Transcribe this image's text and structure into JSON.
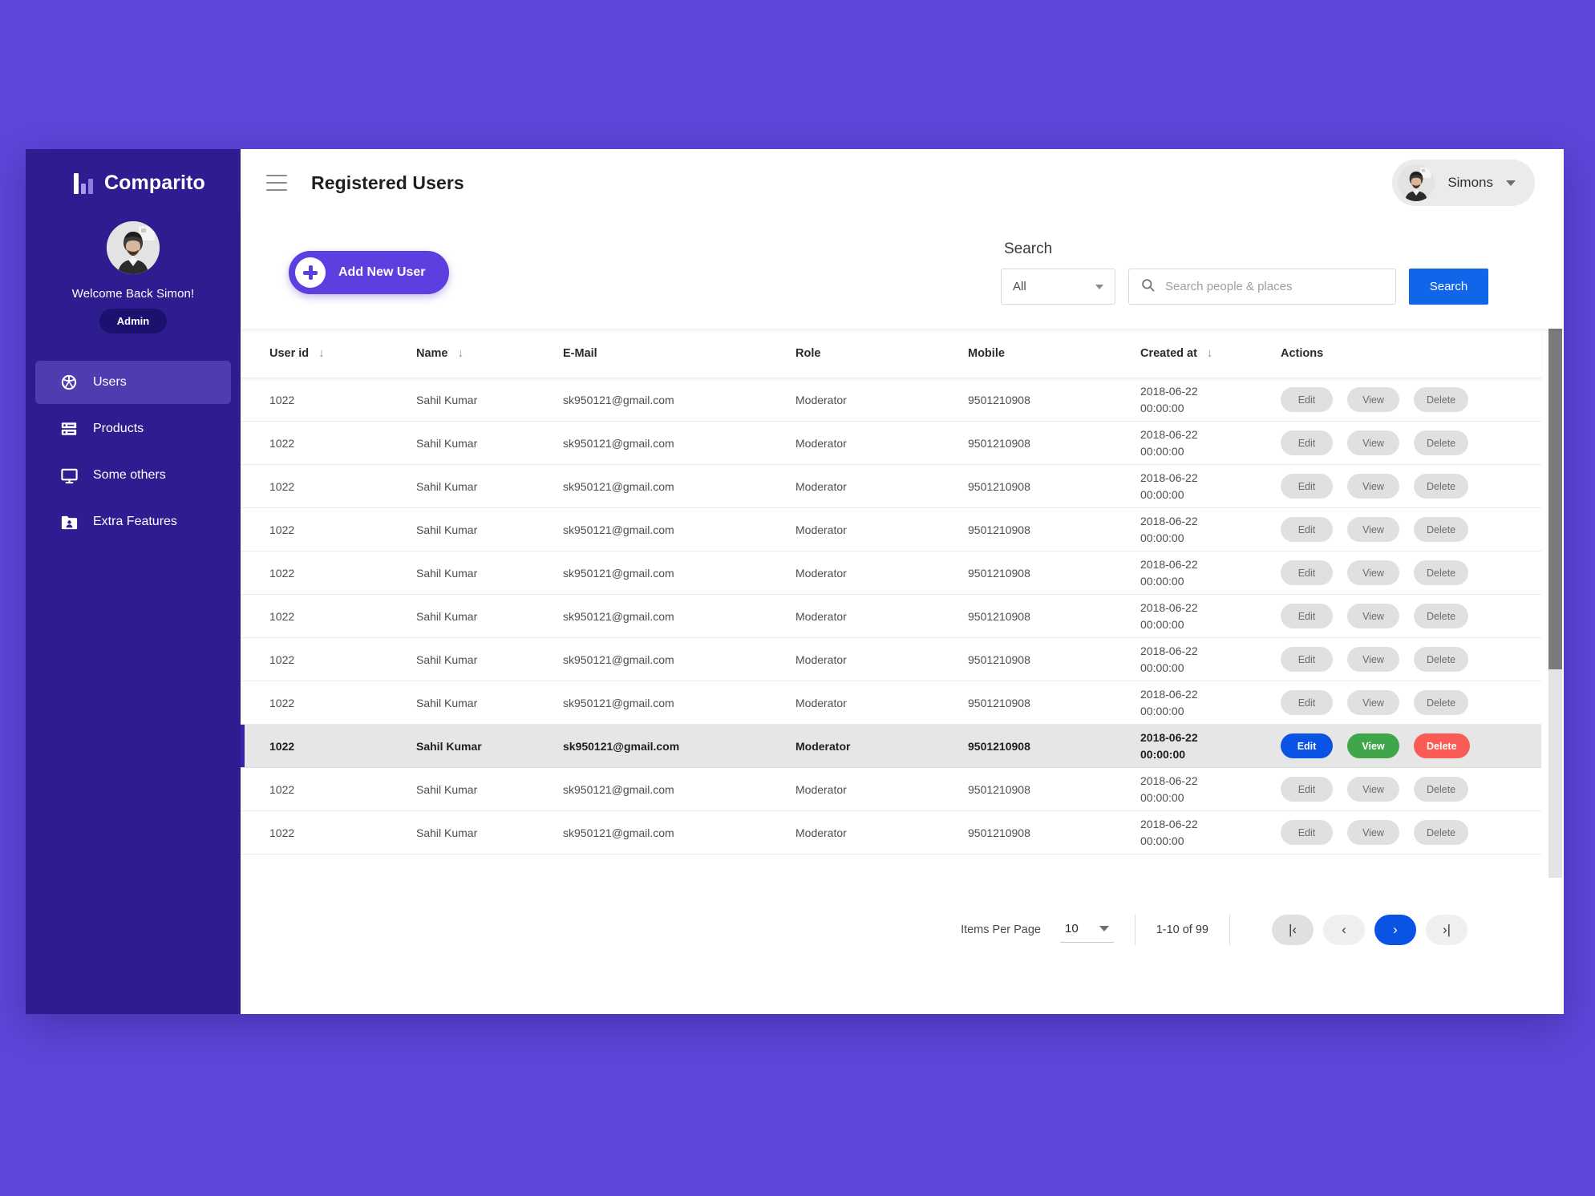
{
  "brand": {
    "name": "Comparito",
    "logo_icon": "bar-chart-logo-icon"
  },
  "sidebar": {
    "profile": {
      "welcome": "Welcome Back Simon!",
      "role_badge": "Admin",
      "avatar_icon": "user-avatar"
    },
    "items": [
      {
        "label": "Users",
        "icon": "users-group-icon",
        "active": true
      },
      {
        "label": "Products",
        "icon": "server-list-icon",
        "active": false
      },
      {
        "label": "Some others",
        "icon": "monitor-icon",
        "active": false
      },
      {
        "label": "Extra Features",
        "icon": "folder-user-icon",
        "active": false
      }
    ]
  },
  "topbar": {
    "menu_icon": "hamburger-menu-icon",
    "title": "Registered Users",
    "user": {
      "name": "Simons",
      "avatar_icon": "user-avatar",
      "caret_icon": "chevron-down-icon"
    }
  },
  "actions": {
    "add_user_label": "Add New User",
    "add_user_icon": "plus-circle-icon"
  },
  "search": {
    "label": "Search",
    "filter_value": "All",
    "filter_options": [
      "All"
    ],
    "filter_caret_icon": "chevron-down-icon",
    "input_value": "",
    "placeholder": "Search people & places",
    "search_icon": "magnifier-icon",
    "button_label": "Search"
  },
  "table": {
    "columns": [
      {
        "label": "User id",
        "sortable": true,
        "sort_icon": "sort-arrow-down-icon"
      },
      {
        "label": "Name",
        "sortable": true,
        "sort_icon": "sort-arrow-down-icon"
      },
      {
        "label": "E-Mail",
        "sortable": false
      },
      {
        "label": "Role",
        "sortable": false
      },
      {
        "label": "Mobile",
        "sortable": false
      },
      {
        "label": "Created at",
        "sortable": true,
        "sort_icon": "sort-arrow-down-icon"
      },
      {
        "label": "Actions",
        "sortable": false
      }
    ],
    "row_action_labels": {
      "edit": "Edit",
      "view": "View",
      "delete": "Delete"
    },
    "highlighted_row_index": 8,
    "rows": [
      {
        "user_id": "1022",
        "name": "Sahil Kumar",
        "email": "sk950121@gmail.com",
        "role": "Moderator",
        "mobile": "9501210908",
        "created_date": "2018-06-22",
        "created_time": "00:00:00"
      },
      {
        "user_id": "1022",
        "name": "Sahil Kumar",
        "email": "sk950121@gmail.com",
        "role": "Moderator",
        "mobile": "9501210908",
        "created_date": "2018-06-22",
        "created_time": "00:00:00"
      },
      {
        "user_id": "1022",
        "name": "Sahil Kumar",
        "email": "sk950121@gmail.com",
        "role": "Moderator",
        "mobile": "9501210908",
        "created_date": "2018-06-22",
        "created_time": "00:00:00"
      },
      {
        "user_id": "1022",
        "name": "Sahil Kumar",
        "email": "sk950121@gmail.com",
        "role": "Moderator",
        "mobile": "9501210908",
        "created_date": "2018-06-22",
        "created_time": "00:00:00"
      },
      {
        "user_id": "1022",
        "name": "Sahil Kumar",
        "email": "sk950121@gmail.com",
        "role": "Moderator",
        "mobile": "9501210908",
        "created_date": "2018-06-22",
        "created_time": "00:00:00"
      },
      {
        "user_id": "1022",
        "name": "Sahil Kumar",
        "email": "sk950121@gmail.com",
        "role": "Moderator",
        "mobile": "9501210908",
        "created_date": "2018-06-22",
        "created_time": "00:00:00"
      },
      {
        "user_id": "1022",
        "name": "Sahil Kumar",
        "email": "sk950121@gmail.com",
        "role": "Moderator",
        "mobile": "9501210908",
        "created_date": "2018-06-22",
        "created_time": "00:00:00"
      },
      {
        "user_id": "1022",
        "name": "Sahil Kumar",
        "email": "sk950121@gmail.com",
        "role": "Moderator",
        "mobile": "9501210908",
        "created_date": "2018-06-22",
        "created_time": "00:00:00"
      },
      {
        "user_id": "1022",
        "name": "Sahil Kumar",
        "email": "sk950121@gmail.com",
        "role": "Moderator",
        "mobile": "9501210908",
        "created_date": "2018-06-22",
        "created_time": "00:00:00"
      },
      {
        "user_id": "1022",
        "name": "Sahil Kumar",
        "email": "sk950121@gmail.com",
        "role": "Moderator",
        "mobile": "9501210908",
        "created_date": "2018-06-22",
        "created_time": "00:00:00"
      },
      {
        "user_id": "1022",
        "name": "Sahil Kumar",
        "email": "sk950121@gmail.com",
        "role": "Moderator",
        "mobile": "9501210908",
        "created_date": "2018-06-22",
        "created_time": "00:00:00"
      }
    ]
  },
  "pagination": {
    "items_per_page_label": "Items Per Page",
    "items_per_page_value": "10",
    "items_per_page_caret_icon": "chevron-down-icon",
    "range_text": "1-10 of 99",
    "buttons": [
      {
        "name": "first-page",
        "glyph": "|‹",
        "style": "first"
      },
      {
        "name": "previous-page",
        "glyph": "‹",
        "style": "plain"
      },
      {
        "name": "next-page",
        "glyph": "›",
        "style": "next"
      },
      {
        "name": "last-page",
        "glyph": "›|",
        "style": "plain"
      }
    ]
  },
  "colors": {
    "page_background": "#5d46da",
    "sidebar": "#2e1d91",
    "sidebar_active": "#4e3cb0",
    "role_badge": "#1d1170",
    "primary_button": "#5d3fe0",
    "search_button": "#1165e8",
    "row_highlight": "#e6e6e6",
    "row_highlight_bar": "#3b22ad",
    "action_edit": "#0a53e4",
    "action_view": "#3fa64a",
    "action_delete": "#fa5b55"
  }
}
